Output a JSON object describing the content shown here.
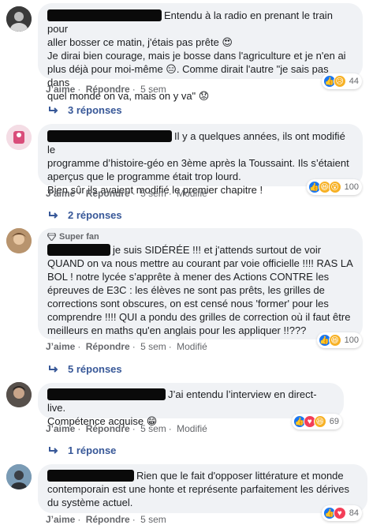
{
  "comments": [
    {
      "text": "Entendu à la radio en prenant le train pour aller bosser ce matin, j'étais pas prête 😍\nJe dirai bien courage, mais je bosse dans l'agriculture et je n'en ai plus déjà pour moi-même 😑. Comme dirait l'autre \"je sais pas dans quel monde on va, mais on y va\" 😟",
      "line1": "Entendu à la radio en prenant le train pour",
      "line2": "aller bosser ce matin, j'étais pas prête 😍",
      "line3": "Je dirai bien courage, mais je bosse dans l'agriculture et je n'en ai",
      "line4": "plus déjà pour moi-même 😑. Comme dirait l'autre \"je sais pas dans",
      "line5": "quel monde on va, mais on y va\" 😟",
      "like": "J’aime",
      "reply": "Répondre",
      "time": "5 sem",
      "reaction_count": "44",
      "reactions": [
        "like-icon",
        "sad-icon"
      ],
      "replies": "3 réponses"
    },
    {
      "line1": "Il y a quelques années, ils ont modifié le",
      "line2": "programme d’histoire-géo en 3ème après la Toussaint. Ils s’étaient",
      "line3": "aperçus que le programme était trop lourd.",
      "line4": "Bien sûr ils avaient modifié le premier chapitre !",
      "like": "J’aime",
      "reply": "Répondre",
      "time": "5 sem",
      "edited": "Modifié",
      "reaction_count": "100",
      "reactions": [
        "like-icon",
        "haha-icon",
        "wow-icon"
      ],
      "replies": "2 réponses"
    },
    {
      "badge": "Super fan",
      "line1": "je suis SIDÉRÉE !!! et j'attends surtout de voir",
      "line2": "QUAND on va nous mettre au courant par voie officielle !!!! RAS LA",
      "line3": "BOL ! notre lycée s’apprête à mener des Actions CONTRE les",
      "line4": "épreuves de E3C : les élèves ne sont pas prêts, les grilles de",
      "line5": "corrections sont obscures, on est censé nous 'former' pour les",
      "line6": "comprendre !!!! QUI a pondu des grilles de correction où il faut être",
      "line7": "meilleurs en maths qu'en anglais pour les appliquer !!???",
      "like": "J’aime",
      "reply": "Répondre",
      "time": "5 sem",
      "edited": "Modifié",
      "reaction_count": "100",
      "reactions": [
        "like-icon",
        "haha-icon"
      ],
      "replies": "5 réponses"
    },
    {
      "line1": "J’ai entendu l’interview en direct-live.",
      "line2": "Compétence acquise 😁",
      "like": "J’aime",
      "reply": "Répondre",
      "time": "5 sem",
      "edited": "Modifié",
      "reaction_count": "69",
      "reactions": [
        "like-icon",
        "love-icon",
        "haha-icon"
      ],
      "replies": "1 réponse"
    },
    {
      "line1": "Rien que le fait d'opposer littérature et monde",
      "line2": "contemporain est une honte et représente parfaitement les dérives",
      "line3": "du système actuel.",
      "like": "J’aime",
      "reply": "Répondre",
      "time": "5 sem",
      "reaction_count": "84",
      "reactions": [
        "like-icon",
        "love-icon"
      ]
    }
  ],
  "colors": {
    "bubble": "#f0f2f5",
    "link": "#385898",
    "meta": "#65676b",
    "like": "#1877f2",
    "love": "#f33e58",
    "haha": "#f7b125"
  }
}
